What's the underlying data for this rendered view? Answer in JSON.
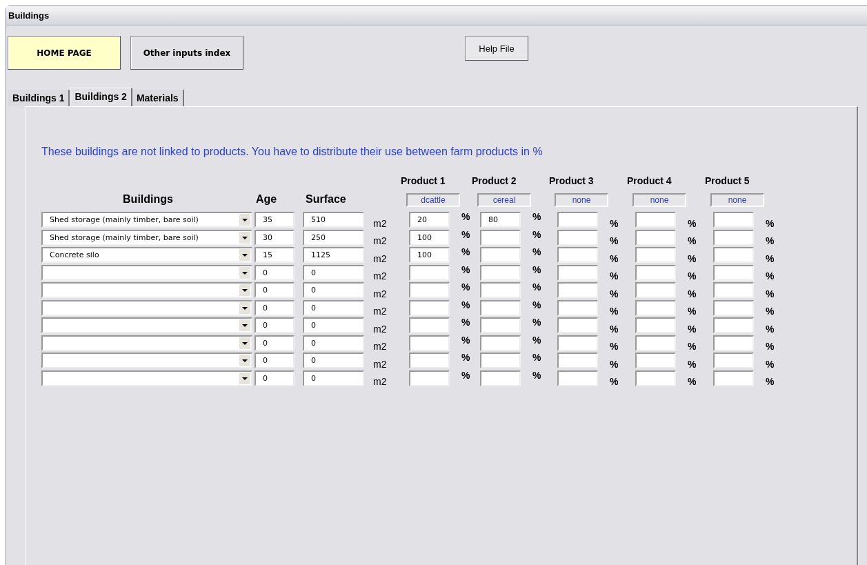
{
  "window": {
    "title": "Buildings"
  },
  "buttons": [
    {
      "label": "HOME PAGE",
      "kind": "home"
    },
    {
      "label": "Other inputs index",
      "kind": "nav"
    }
  ],
  "help_button": {
    "label": "Help File"
  },
  "tabs": [
    {
      "label": "Buildings 1",
      "selected": false
    },
    {
      "label": "Buildings 2",
      "selected": true
    },
    {
      "label": "Materials",
      "selected": false
    }
  ],
  "instruction": "These buildings are not linked to products. You have to distribute their use between farm products in %",
  "columns": {
    "building": "Buildings",
    "age": "Age",
    "surface": "Surface"
  },
  "products": [
    {
      "header": "Product 1",
      "name": "dcattle"
    },
    {
      "header": "Product 2",
      "name": "cereal"
    },
    {
      "header": "Product 3",
      "name": "none"
    },
    {
      "header": "Product 4",
      "name": "none"
    },
    {
      "header": "Product 5",
      "name": "none"
    }
  ],
  "rows": [
    {
      "building": "Shed storage (mainly timber, bare soil)",
      "age": "35",
      "surface": "510",
      "unit": "m2",
      "shares": [
        {
          "value": "20",
          "unit": "%"
        },
        {
          "value": "80",
          "unit": "%"
        },
        {
          "unit": "%"
        },
        {
          "unit": "%"
        },
        {
          "unit": "%"
        }
      ]
    },
    {
      "building": "Shed storage (mainly timber, bare soil)",
      "age": "30",
      "surface": "250",
      "unit": "m2",
      "shares": [
        {
          "value": "100",
          "unit": "%"
        },
        {
          "unit": "%"
        },
        {
          "unit": "%"
        },
        {
          "unit": "%"
        },
        {
          "unit": "%"
        }
      ]
    },
    {
      "building": "Concrete silo",
      "age": "15",
      "surface": "1125",
      "unit": "m2",
      "shares": [
        {
          "value": "100",
          "unit": "%"
        },
        {
          "unit": "%"
        },
        {
          "unit": "%"
        },
        {
          "unit": "%"
        },
        {
          "unit": "%"
        }
      ]
    },
    {
      "age": "0",
      "surface": "0",
      "unit": "m2",
      "shares": [
        {
          "unit": "%"
        },
        {
          "unit": "%"
        },
        {
          "unit": "%"
        },
        {
          "unit": "%"
        },
        {
          "unit": "%"
        }
      ]
    },
    {
      "age": "0",
      "surface": "0",
      "unit": "m2",
      "shares": [
        {
          "unit": "%"
        },
        {
          "unit": "%"
        },
        {
          "unit": "%"
        },
        {
          "unit": "%"
        },
        {
          "unit": "%"
        }
      ]
    },
    {
      "age": "0",
      "surface": "0",
      "unit": "m2",
      "shares": [
        {
          "unit": "%"
        },
        {
          "unit": "%"
        },
        {
          "unit": "%"
        },
        {
          "unit": "%"
        },
        {
          "unit": "%"
        }
      ]
    },
    {
      "age": "0",
      "surface": "0",
      "unit": "m2",
      "shares": [
        {
          "unit": "%"
        },
        {
          "unit": "%"
        },
        {
          "unit": "%"
        },
        {
          "unit": "%"
        },
        {
          "unit": "%"
        }
      ]
    },
    {
      "age": "0",
      "surface": "0",
      "unit": "m2",
      "shares": [
        {
          "unit": "%"
        },
        {
          "unit": "%"
        },
        {
          "unit": "%"
        },
        {
          "unit": "%"
        },
        {
          "unit": "%"
        }
      ]
    },
    {
      "age": "0",
      "surface": "0",
      "unit": "m2",
      "shares": [
        {
          "unit": "%"
        },
        {
          "unit": "%"
        },
        {
          "unit": "%"
        },
        {
          "unit": "%"
        },
        {
          "unit": "%"
        }
      ]
    },
    {
      "age": "0",
      "surface": "0",
      "unit": "m2",
      "shares": [
        {
          "unit": "%"
        },
        {
          "unit": "%"
        },
        {
          "unit": "%"
        },
        {
          "unit": "%"
        },
        {
          "unit": "%"
        }
      ]
    }
  ]
}
